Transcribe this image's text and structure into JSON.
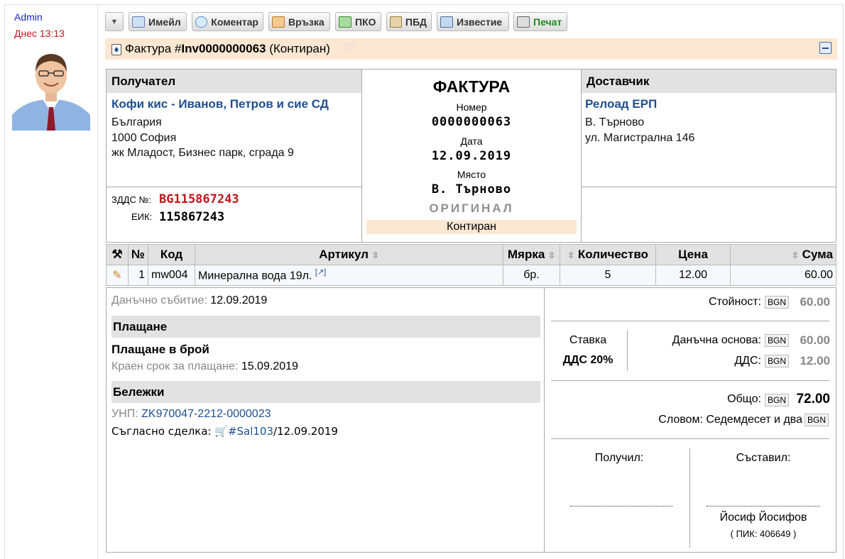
{
  "author": {
    "name": "Admin",
    "date": "Днес 13:13"
  },
  "toolbar": {
    "buttons": [
      {
        "label": "Имейл",
        "icon": "email-icon"
      },
      {
        "label": "Коментар",
        "icon": "comment-icon"
      },
      {
        "label": "Връзка",
        "icon": "link-icon"
      },
      {
        "label": "ПКО",
        "icon": "cash-receipt-icon"
      },
      {
        "label": "ПБД",
        "icon": "bank-receipt-icon"
      },
      {
        "label": "Известие",
        "icon": "notice-icon"
      },
      {
        "label": "Печат",
        "icon": "printer-icon"
      }
    ]
  },
  "title": {
    "prefix": "Фактура #",
    "number": "Inv0000000063",
    "state": " (Контиран)"
  },
  "recipient": {
    "heading": "Получател",
    "name": "Кофи кис - Иванов, Петров и сие СД",
    "country": "България",
    "city": "1000 София",
    "address": "жк Младост, Бизнес парк, сграда 9",
    "vat_label": "ЗДДС №:",
    "vat": "BG115867243",
    "eik_label": "ЕИК:",
    "eik": "115867243"
  },
  "invoice": {
    "title": "ФАКТУРА",
    "number_label": "Номер",
    "number": "0000000063",
    "date_label": "Дата",
    "date": "12.09.2019",
    "place_label": "Място",
    "place": "В. Търново",
    "original": "ОРИГИНАЛ",
    "state": "Контиран"
  },
  "supplier": {
    "heading": "Доставчик",
    "name": "Релоад ЕРП",
    "city": "В. Търново",
    "address": "ул. Магистрална 146"
  },
  "table": {
    "headers": {
      "num": "№",
      "code": "Код",
      "article": "Артикул",
      "unit": "Мярка",
      "qty": "Количество",
      "price": "Цена",
      "sum": "Сума"
    },
    "rows": [
      {
        "num": "1",
        "code": "mw004",
        "article": "Минерална вода 19л.",
        "unit": "бр.",
        "qty": "5",
        "price": "12.00",
        "sum": "60.00"
      }
    ]
  },
  "details": {
    "tax_event_label": "Данъчно събитие:",
    "tax_event": "12.09.2019",
    "payment_heading": "Плащане",
    "payment_method": "Плащане в брой",
    "due_label": "Краен срок за плащане:",
    "due": "15.09.2019",
    "notes_heading": "Бележки",
    "unp_label": "УНП:",
    "unp": "ZK970047-2212-0000023",
    "deal_prefix": "Съгласно сделка: ",
    "deal_link": "#Sal103",
    "deal_date": "/12.09.2019"
  },
  "totals": {
    "currency": "BGN",
    "value_label": "Стойност:",
    "value": "60.00",
    "rate_label": "Ставка",
    "rate": "ДДС 20%",
    "base_label": "Данъчна основа:",
    "base": "60.00",
    "vat_label": "ДДС:",
    "vat": "12.00",
    "total_label": "Общо:",
    "total": "72.00",
    "words_label": "Словом: Седемдесет и два"
  },
  "signatures": {
    "received_label": "Получил:",
    "compiled_label": "Съставил:",
    "compiled_name": "Йосиф Йосифов",
    "compiled_pik": "( ПИК: 406649 )"
  }
}
